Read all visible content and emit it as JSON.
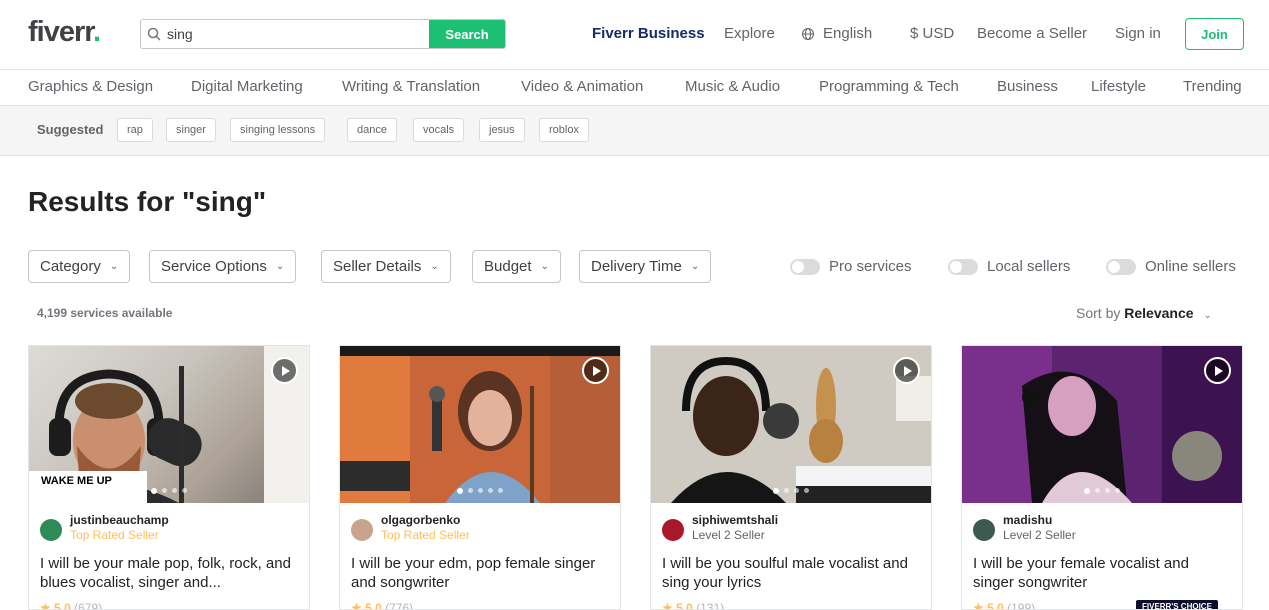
{
  "header": {
    "logo": "fiverr",
    "logo_dot": ".",
    "search_value": "sing",
    "search_button": "Search",
    "nav": {
      "business": "Fiverr Business",
      "explore": "Explore",
      "language": "English",
      "currency": "$ USD",
      "become_seller": "Become a Seller",
      "sign_in": "Sign in",
      "join": "Join"
    }
  },
  "categories": [
    "Graphics & Design",
    "Digital Marketing",
    "Writing & Translation",
    "Video & Animation",
    "Music & Audio",
    "Programming & Tech",
    "Business",
    "Lifestyle",
    "Trending"
  ],
  "suggested": {
    "label": "Suggested",
    "tags": [
      "rap",
      "singer",
      "singing lessons",
      "dance",
      "vocals",
      "jesus",
      "roblox"
    ]
  },
  "results_title": "Results for \"sing\"",
  "filters": [
    "Category",
    "Service Options",
    "Seller Details",
    "Budget",
    "Delivery Time"
  ],
  "toggles": [
    "Pro services",
    "Local sellers",
    "Online sellers"
  ],
  "services_count": "4,199 services available",
  "sort": {
    "label": "Sort by",
    "value": "Relevance"
  },
  "cards": [
    {
      "seller": "justinbeauchamp",
      "level": "Top Rated Seller",
      "title": "I will be your male pop, folk, rock, and blues vocalist, singer and...",
      "rating": "★ 5.0",
      "reviews": "(679)",
      "overlay_text": "WAKE ME UP"
    },
    {
      "seller": "olgagorbenko",
      "level": "Top Rated Seller",
      "title": "I will be your edm, pop female singer and songwriter",
      "rating": "★ 5.0",
      "reviews": "(776)"
    },
    {
      "seller": "siphiwemtshali",
      "level": "Level 2 Seller",
      "title": "I will be you soulful male vocalist and sing your lyrics",
      "rating": "★ 5.0",
      "reviews": "(131)"
    },
    {
      "seller": "madishu",
      "level": "Level 2 Seller",
      "title": "I will be your female vocalist and singer songwriter",
      "rating": "★ 5.0",
      "reviews": "(199)",
      "badge": "FIVERR'S CHOICE"
    }
  ],
  "colors": {
    "brand_green": "#1dbf73",
    "business_blue": "#1a2b6d",
    "top_rated": "#ffbe5b"
  }
}
